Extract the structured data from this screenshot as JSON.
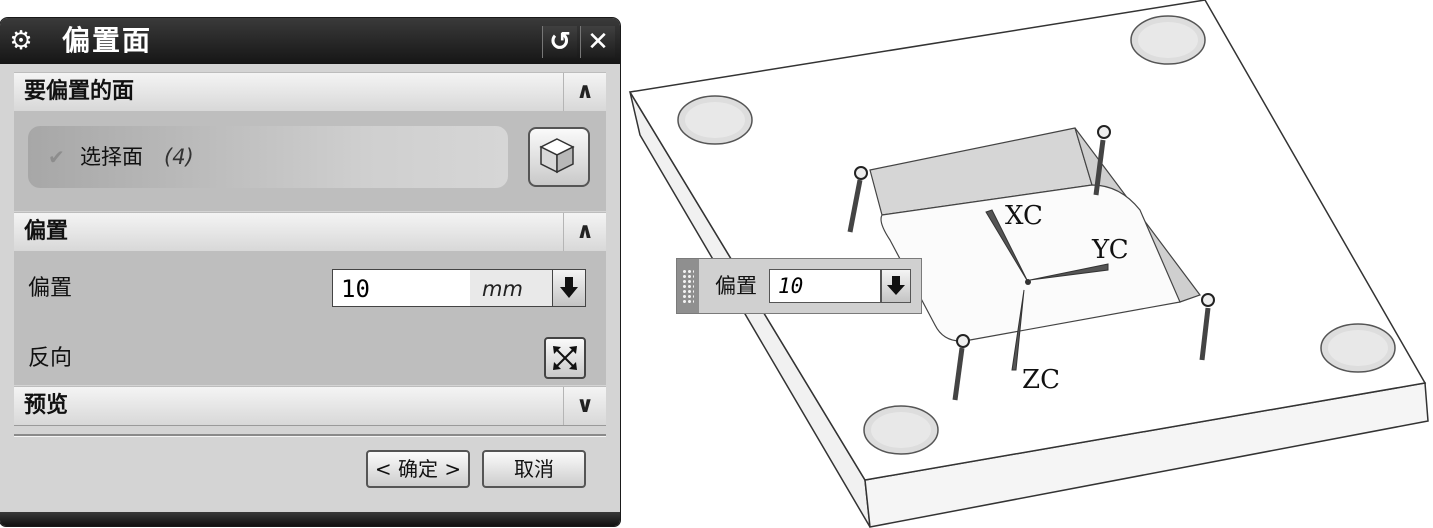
{
  "dialog": {
    "title": "偏置面",
    "title_icon": "gear-icon",
    "reset_icon": "reset-icon",
    "close_icon": "close-icon"
  },
  "section_faces": {
    "label": "要偏置的面",
    "toggle": "∧",
    "select_label": "选择面",
    "select_count": "(4)",
    "select_icon": "cube-icon"
  },
  "section_offset": {
    "label": "偏置",
    "toggle": "∧",
    "offset_label": "偏置",
    "offset_value": "10",
    "unit": "mm",
    "reverse_label": "反向",
    "reverse_icon": "reverse-direction-icon"
  },
  "section_preview": {
    "label": "预览",
    "toggle": "∨"
  },
  "buttons": {
    "ok": "< 确定 >",
    "cancel": "取消"
  },
  "viewport": {
    "axis_x": "XC",
    "axis_y": "YC",
    "axis_z": "ZC",
    "float_label": "偏置",
    "float_value": "10"
  }
}
